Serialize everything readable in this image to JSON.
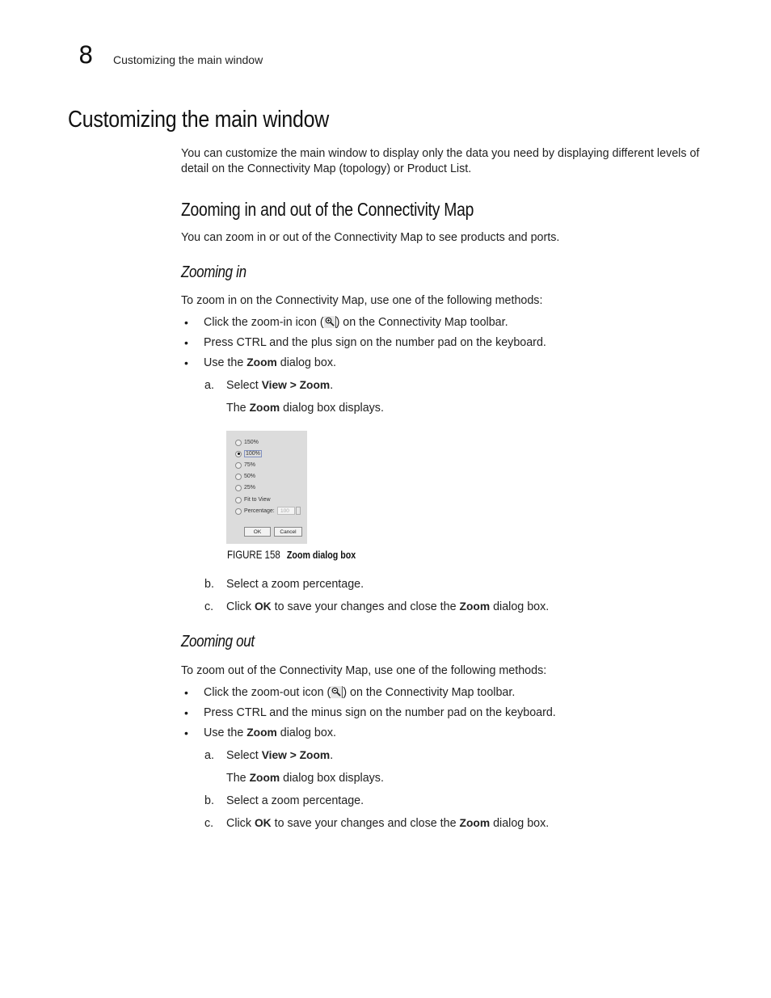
{
  "header": {
    "chapter_number": "8",
    "running_title": "Customizing the main window"
  },
  "title": "Customizing the main window",
  "intro": "You can customize the main window to display only the data you need by displaying different levels of detail on the Connectivity Map (topology) or Product List.",
  "section": {
    "heading": "Zooming in and out of the Connectivity Map",
    "intro": "You can zoom in or out of the Connectivity Map to see products and ports."
  },
  "zoom_in": {
    "heading": "Zooming in",
    "lead": "To zoom in on the Connectivity Map, use one of the following methods:",
    "bullet1_pre": "Click the zoom-in icon (",
    "bullet1_icon": "zoom-in-icon",
    "bullet1_post": ") on the Connectivity Map toolbar.",
    "bullet2": "Press CTRL and the plus sign on the number pad on the keyboard.",
    "bullet3_pre": "Use the ",
    "bullet3_bold": "Zoom",
    "bullet3_post": " dialog box.",
    "step_a_letter": "a.",
    "step_a_pre": "Select ",
    "step_a_bold": "View > Zoom",
    "step_a_post": ".",
    "step_a_result_pre": "The ",
    "step_a_result_bold": "Zoom",
    "step_a_result_post": " dialog box displays.",
    "step_b_letter": "b.",
    "step_b": "Select a zoom percentage.",
    "step_c_letter": "c.",
    "step_c_pre": "Click ",
    "step_c_bold1": "OK",
    "step_c_mid": " to save your changes and close the ",
    "step_c_bold2": "Zoom",
    "step_c_post": " dialog box."
  },
  "figure": {
    "label": "FIGURE 158",
    "title": "Zoom dialog box",
    "dialog": {
      "options": [
        {
          "label": "150%",
          "selected": false
        },
        {
          "label": "100%",
          "selected": true
        },
        {
          "label": "75%",
          "selected": false
        },
        {
          "label": "50%",
          "selected": false
        },
        {
          "label": "25%",
          "selected": false
        },
        {
          "label": "Fit to View",
          "selected": false
        },
        {
          "label": "Percentage:",
          "selected": false
        }
      ],
      "percentage_value": "100",
      "ok_label": "OK",
      "cancel_label": "Cancel"
    }
  },
  "zoom_out": {
    "heading": "Zooming out",
    "lead": "To zoom out of the Connectivity Map, use one of the following methods:",
    "bullet1_pre": "Click the zoom-out icon (",
    "bullet1_icon": "zoom-out-icon",
    "bullet1_post": ") on the Connectivity Map toolbar.",
    "bullet2": "Press CTRL and the minus sign on the number pad on the keyboard.",
    "bullet3_pre": "Use the ",
    "bullet3_bold": "Zoom",
    "bullet3_post": " dialog box.",
    "step_a_letter": "a.",
    "step_a_pre": "Select ",
    "step_a_bold": "View > Zoom",
    "step_a_post": ".",
    "step_a_result_pre": "The ",
    "step_a_result_bold": "Zoom",
    "step_a_result_post": " dialog box displays.",
    "step_b_letter": "b.",
    "step_b": "Select a zoom percentage.",
    "step_c_letter": "c.",
    "step_c_pre": "Click ",
    "step_c_bold1": "OK",
    "step_c_mid": " to save your changes and close the ",
    "step_c_bold2": "Zoom",
    "step_c_post": " dialog box."
  },
  "bullet_glyph": "•"
}
